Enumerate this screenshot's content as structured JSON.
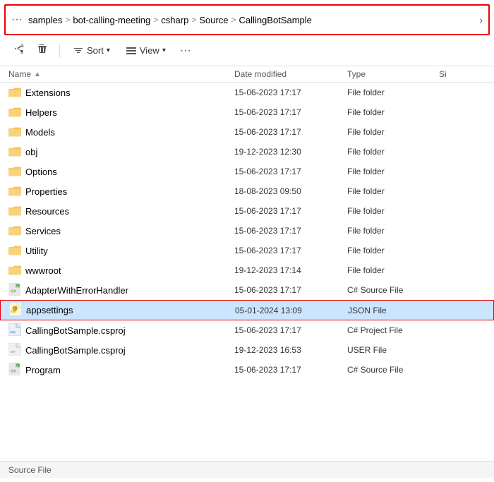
{
  "breadcrumb": {
    "items": [
      {
        "label": "samples"
      },
      {
        "label": "bot-calling-meeting"
      },
      {
        "label": "csharp"
      },
      {
        "label": "Source"
      },
      {
        "label": "CallingBotSample"
      }
    ],
    "separator": ">"
  },
  "toolbar": {
    "share_label": "",
    "delete_label": "",
    "sort_label": "Sort",
    "view_label": "View",
    "more_label": "···"
  },
  "columns": {
    "name": "Name",
    "date_modified": "Date modified",
    "type": "Type",
    "size": "Si"
  },
  "files": [
    {
      "id": 1,
      "name": "Extensions",
      "icon": "folder",
      "date": "15-06-2023 17:17",
      "type": "File folder",
      "size": ""
    },
    {
      "id": 2,
      "name": "Helpers",
      "icon": "folder",
      "date": "15-06-2023 17:17",
      "type": "File folder",
      "size": ""
    },
    {
      "id": 3,
      "name": "Models",
      "icon": "folder",
      "date": "15-06-2023 17:17",
      "type": "File folder",
      "size": ""
    },
    {
      "id": 4,
      "name": "obj",
      "icon": "folder",
      "date": "19-12-2023 12:30",
      "type": "File folder",
      "size": ""
    },
    {
      "id": 5,
      "name": "Options",
      "icon": "folder",
      "date": "15-06-2023 17:17",
      "type": "File folder",
      "size": ""
    },
    {
      "id": 6,
      "name": "Properties",
      "icon": "folder",
      "date": "18-08-2023 09:50",
      "type": "File folder",
      "size": ""
    },
    {
      "id": 7,
      "name": "Resources",
      "icon": "folder",
      "date": "15-06-2023 17:17",
      "type": "File folder",
      "size": ""
    },
    {
      "id": 8,
      "name": "Services",
      "icon": "folder",
      "date": "15-06-2023 17:17",
      "type": "File folder",
      "size": ""
    },
    {
      "id": 9,
      "name": "Utility",
      "icon": "folder",
      "date": "15-06-2023 17:17",
      "type": "File folder",
      "size": ""
    },
    {
      "id": 10,
      "name": "wwwroot",
      "icon": "folder",
      "date": "19-12-2023 17:14",
      "type": "File folder",
      "size": ""
    },
    {
      "id": 11,
      "name": "AdapterWithErrorHandler",
      "icon": "cs",
      "date": "15-06-2023 17:17",
      "type": "C# Source File",
      "size": ""
    },
    {
      "id": 12,
      "name": "appsettings",
      "icon": "json",
      "date": "05-01-2024 13:09",
      "type": "JSON File",
      "size": "",
      "selected": true
    },
    {
      "id": 13,
      "name": "CallingBotSample.csproj",
      "icon": "csproj",
      "date": "15-06-2023 17:17",
      "type": "C# Project File",
      "size": ""
    },
    {
      "id": 14,
      "name": "CallingBotSample.csproj",
      "icon": "user",
      "date": "19-12-2023 16:53",
      "type": "USER File",
      "size": ""
    },
    {
      "id": 15,
      "name": "Program",
      "icon": "cs",
      "date": "15-06-2023 17:17",
      "type": "C# Source File",
      "size": ""
    }
  ],
  "status_bar": {
    "text": "Source File"
  },
  "colors": {
    "folder_yellow": "#f6c358",
    "selected_bg": "#cde8ff",
    "selected_border": "#cc0000",
    "breadcrumb_border": "#cc0000"
  }
}
